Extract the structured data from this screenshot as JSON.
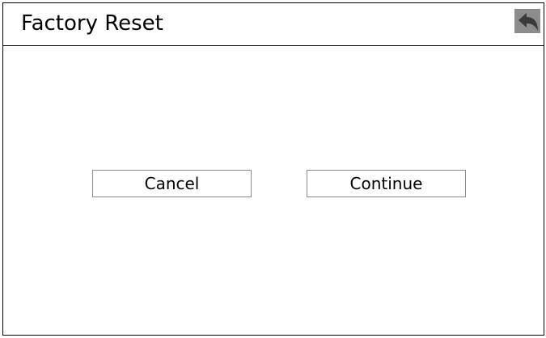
{
  "header": {
    "title": "Factory Reset",
    "back_icon": "back-arrow-icon"
  },
  "actions": {
    "cancel_label": "Cancel",
    "continue_label": "Continue"
  },
  "colors": {
    "border": "#000000",
    "button_border": "#8a8a8a",
    "back_button_bg": "#8c8c8c",
    "back_arrow": "#3a3a3a"
  }
}
